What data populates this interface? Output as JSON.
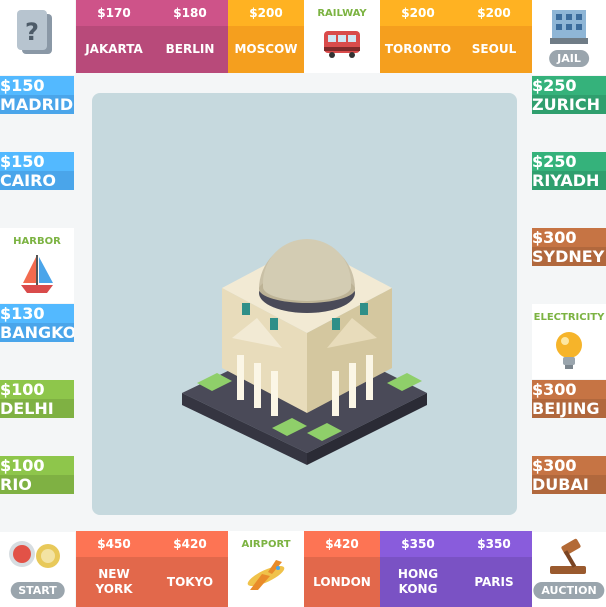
{
  "colors": {
    "pink": "#b84a7a",
    "orange": "#f59f1e",
    "blue": "#4aa5ea",
    "green": "#7fb143",
    "red": "#e2684b",
    "purple": "#7a52c4",
    "teal": "#2f9f6e",
    "brown": "#b1683d"
  },
  "corners": {
    "jail": "JAIL",
    "start": "START",
    "auction": "AUCTION",
    "chance_icon": "question-icon"
  },
  "top": [
    {
      "price": "$170",
      "name": "JAKARTA",
      "color": "pink"
    },
    {
      "price": "$180",
      "name": "BERLIN",
      "color": "pink"
    },
    {
      "price": "$200",
      "name": "MOSCOW",
      "color": "orange"
    },
    {
      "label": "RAILWAY",
      "icon": "train-icon"
    },
    {
      "price": "$200",
      "name": "TORONTO",
      "color": "orange"
    },
    {
      "price": "$200",
      "name": "SEOUL",
      "color": "orange"
    }
  ],
  "left": [
    {
      "price": "$150",
      "name": "MADRID",
      "color": "blue"
    },
    {
      "price": "$150",
      "name": "CAIRO",
      "color": "blue"
    },
    {
      "label": "HARBOR",
      "icon": "sailboat-icon"
    },
    {
      "price": "$130",
      "name": "BANGKOK",
      "color": "blue"
    },
    {
      "price": "$100",
      "name": "DELHI",
      "color": "green"
    },
    {
      "price": "$100",
      "name": "RIO",
      "color": "green"
    }
  ],
  "right": [
    {
      "price": "$250",
      "name": "ZURICH",
      "color": "teal"
    },
    {
      "price": "$250",
      "name": "RIYADH",
      "color": "teal"
    },
    {
      "price": "$300",
      "name": "SYDNEY",
      "color": "brown"
    },
    {
      "label": "ELECTRICITY",
      "icon": "lightbulb-icon"
    },
    {
      "price": "$300",
      "name": "BEIJING",
      "color": "brown"
    },
    {
      "price": "$300",
      "name": "DUBAI",
      "color": "brown"
    }
  ],
  "bottom": [
    {
      "price": "$450",
      "name": "NEW\nYORK",
      "color": "red"
    },
    {
      "price": "$420",
      "name": "TOKYO",
      "color": "red"
    },
    {
      "label": "AIRPORT",
      "icon": "airplane-icon"
    },
    {
      "price": "$420",
      "name": "LONDON",
      "color": "red"
    },
    {
      "price": "$350",
      "name": "HONG\nKONG",
      "color": "purple"
    },
    {
      "price": "$350",
      "name": "PARIS",
      "color": "purple"
    }
  ]
}
